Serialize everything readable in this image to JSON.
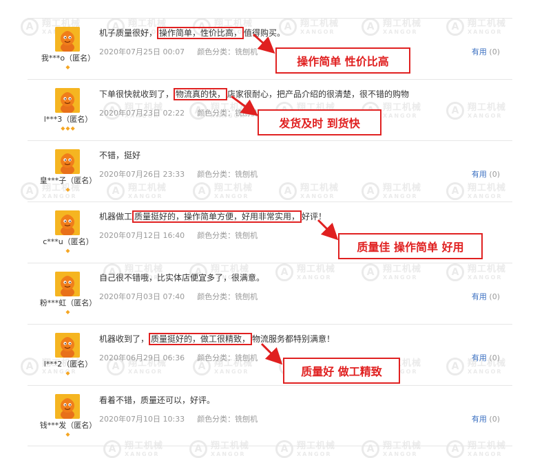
{
  "watermark": {
    "text": "翔工机械",
    "sub": "XANGOR",
    "logo_glyph": "A"
  },
  "colors": {
    "highlight": "#e02020",
    "link": "#3a6fc1",
    "meta": "#999999",
    "level": "#f5a623",
    "avatar_bg": "#f5b521"
  },
  "reviews": [
    {
      "user": "我***o（匿名）",
      "level": 1,
      "content_before": "机子质量很好，",
      "content_highlight": "操作简单，性价比高，",
      "content_after": "值得购买。",
      "date": "2020年07月25日 00:07",
      "color": "颜色分类：铣刨机",
      "useful_label": "有用",
      "useful_count": "(0)",
      "callout": "操作简单  性价比高"
    },
    {
      "user": "l***3（匿名）",
      "level": 3,
      "content_before": "下单很快就收到了，",
      "content_highlight": "物流真的快，",
      "content_after": "店家很耐心，把产品介绍的很清楚，很不错的购物",
      "date": "2020年07月23日 02:22",
      "color": "颜色分类：铣刨机",
      "useful_label": "",
      "useful_count": "",
      "callout": "发货及时  到货快"
    },
    {
      "user": "皇***子（匿名）",
      "level": 1,
      "content_before": "不错，挺好",
      "content_highlight": "",
      "content_after": "",
      "date": "2020年07月26日 23:33",
      "color": "颜色分类：铣刨机",
      "useful_label": "有用",
      "useful_count": "(0)",
      "callout": ""
    },
    {
      "user": "c***u（匿名）",
      "level": 1,
      "content_before": "机器做工",
      "content_highlight": "质量挺好的，操作简单方便，好用非常实用，",
      "content_after": "好评！",
      "date": "2020年07月12日 16:40",
      "color": "颜色分类：铣刨机",
      "useful_label": "",
      "useful_count": "",
      "callout": "质量佳  操作简单  好用"
    },
    {
      "user": "粉***虹（匿名）",
      "level": 1,
      "content_before": "自己很不错哦，比实体店便宜多了，很满意。",
      "content_highlight": "",
      "content_after": "",
      "date": "2020年07月03日 07:40",
      "color": "颜色分类：铣刨机",
      "useful_label": "有用",
      "useful_count": "(0)",
      "callout": ""
    },
    {
      "user": "l***2（匿名）",
      "level": 1,
      "content_before": "机器收到了，",
      "content_highlight": "质量挺好的，做工很精致，",
      "content_after": "物流服务都特别满意！",
      "date": "2020年06月29日 06:36",
      "color": "颜色分类：铣刨机",
      "useful_label": "有用",
      "useful_count": "(0)",
      "callout": "质量好  做工精致"
    },
    {
      "user": "钱***发（匿名）",
      "level": 1,
      "content_before": "看着不错，质量还可以，好评。",
      "content_highlight": "",
      "content_after": "",
      "date": "2020年07月10日 10:33",
      "color": "颜色分类：铣刨机",
      "useful_label": "有用",
      "useful_count": "(0)",
      "callout": ""
    }
  ]
}
